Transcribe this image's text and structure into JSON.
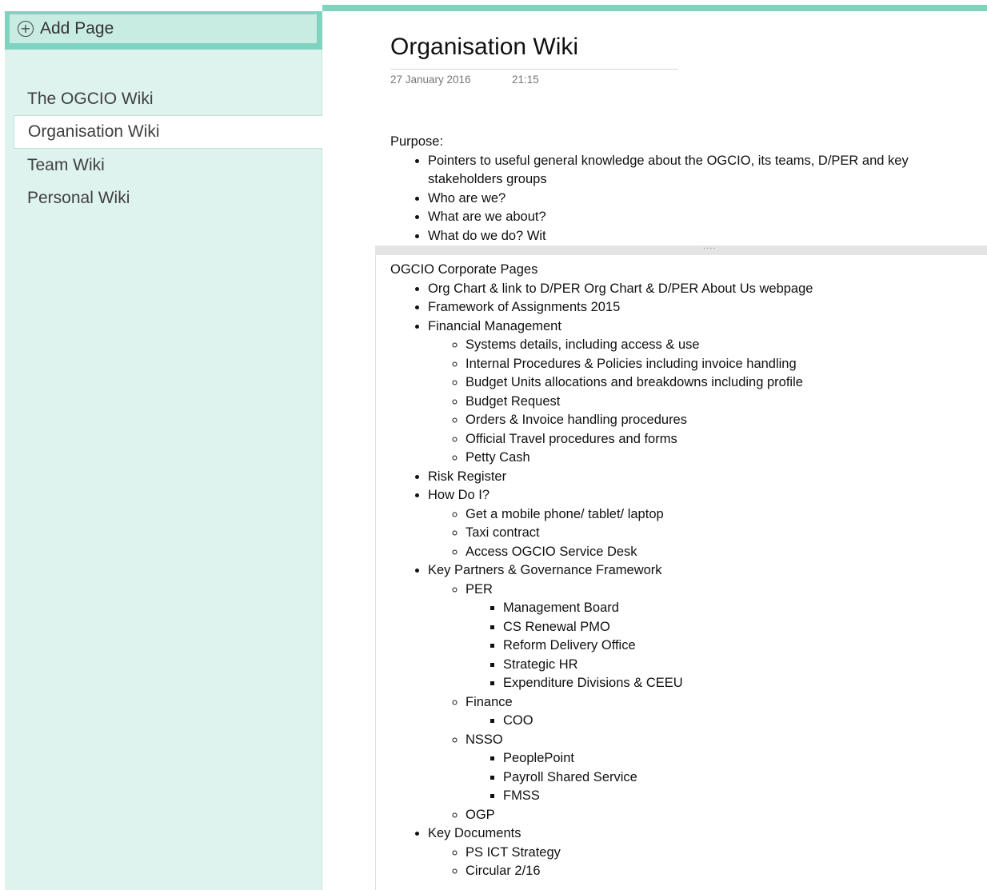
{
  "sidebar": {
    "add_page": "Add Page",
    "items": [
      {
        "label": "The OGCIO Wiki"
      },
      {
        "label": "Organisation Wiki"
      },
      {
        "label": "Team Wiki"
      },
      {
        "label": "Personal Wiki"
      }
    ],
    "selected_index": 1
  },
  "page": {
    "title": "Organisation Wiki",
    "date": "27 January 2016",
    "time": "21:15",
    "purpose_heading": "Purpose:",
    "purpose_items": [
      "Pointers to useful general knowledge about the OGCIO, its teams, D/PER and key stakeholders groups",
      "Who are we?",
      "What are we about?",
      "What do we do?  Wit"
    ],
    "splitter_grip": "····",
    "corporate_heading": "OGCIO Corporate Pages",
    "corporate": {
      "org_chart": "Org Chart & link to D/PER Org Chart & D/PER About Us webpage",
      "framework": "Framework of Assignments 2015",
      "financial": {
        "label": "Financial Management",
        "items": [
          "Systems details, including access & use",
          "Internal Procedures & Policies including invoice handling",
          "Budget Units allocations and breakdowns including profile",
          "Budget Request",
          "Orders & Invoice handling procedures",
          "Official Travel procedures and forms",
          "Petty Cash"
        ]
      },
      "risk": "Risk Register",
      "how_do_i": {
        "label": "How Do I?",
        "items": [
          "Get a mobile phone/ tablet/ laptop",
          "Taxi contract",
          "Access OGCIO Service Desk"
        ]
      },
      "partners": {
        "label": "Key Partners & Governance Framework",
        "per": {
          "label": "PER",
          "items": [
            "Management Board",
            "CS Renewal PMO",
            "Reform Delivery Office",
            "Strategic HR",
            "Expenditure Divisions & CEEU"
          ]
        },
        "finance": {
          "label": "Finance",
          "items": [
            "COO"
          ]
        },
        "nsso": {
          "label": "NSSO",
          "items": [
            "PeoplePoint",
            "Payroll Shared Service",
            "FMSS"
          ]
        },
        "ogp": "OGP"
      },
      "documents": {
        "label": "Key Documents",
        "items": [
          "PS ICT Strategy",
          "Circular 2/16"
        ]
      }
    }
  },
  "colors": {
    "accent": "#80d4bf",
    "sidebar_bg": "#dff3ee",
    "add_page_bg": "#c9ece2"
  },
  "icons": {
    "add_page": "plus-circle-icon"
  }
}
